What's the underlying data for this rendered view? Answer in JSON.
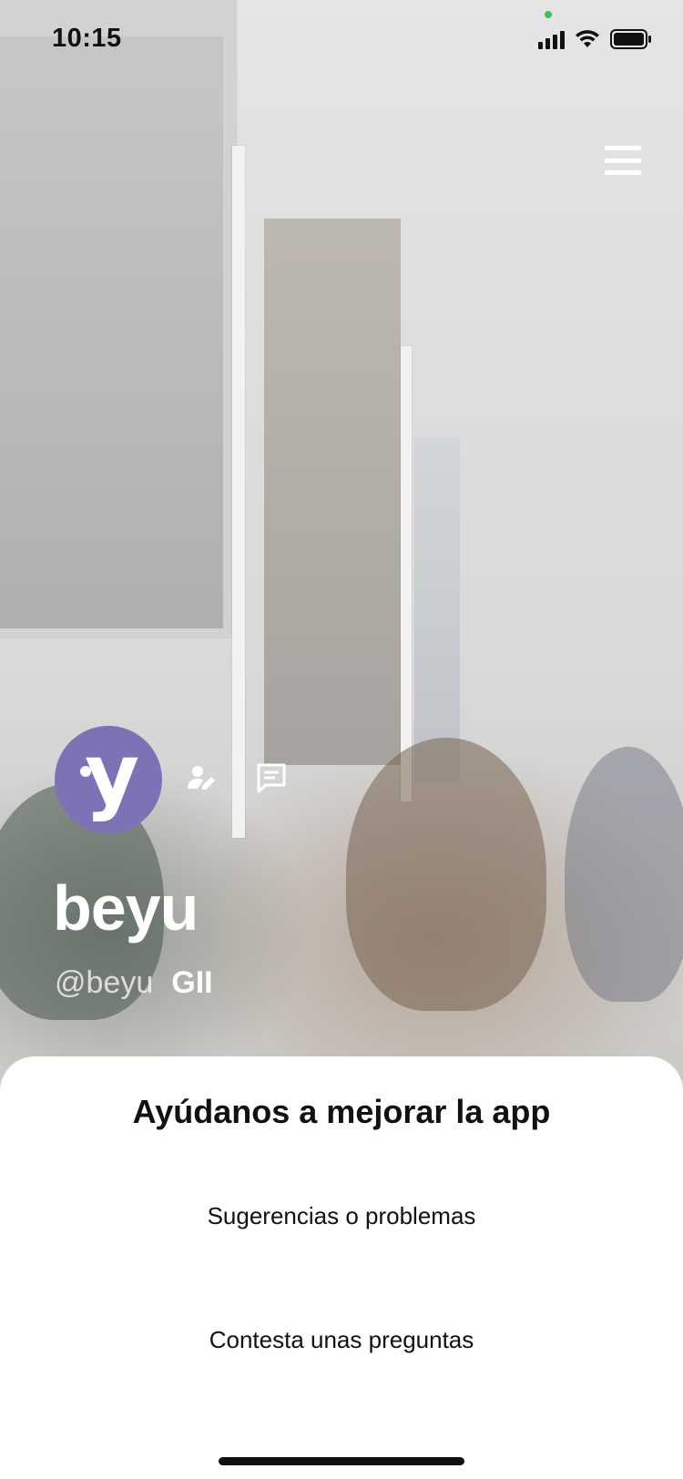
{
  "status_bar": {
    "time": "10:15"
  },
  "profile": {
    "name": "beyu",
    "handle": "@beyu",
    "tag": "GII",
    "avatar_letter": "y",
    "avatar_color": "#7b73b5"
  },
  "icons": {
    "menu": "hamburger-menu-icon",
    "edit": "edit-profile-icon",
    "chat": "chat-icon"
  },
  "sheet": {
    "title": "Ayúdanos a mejorar la app",
    "options": [
      {
        "label": "Sugerencias o problemas"
      },
      {
        "label": "Contesta unas preguntas"
      }
    ]
  }
}
